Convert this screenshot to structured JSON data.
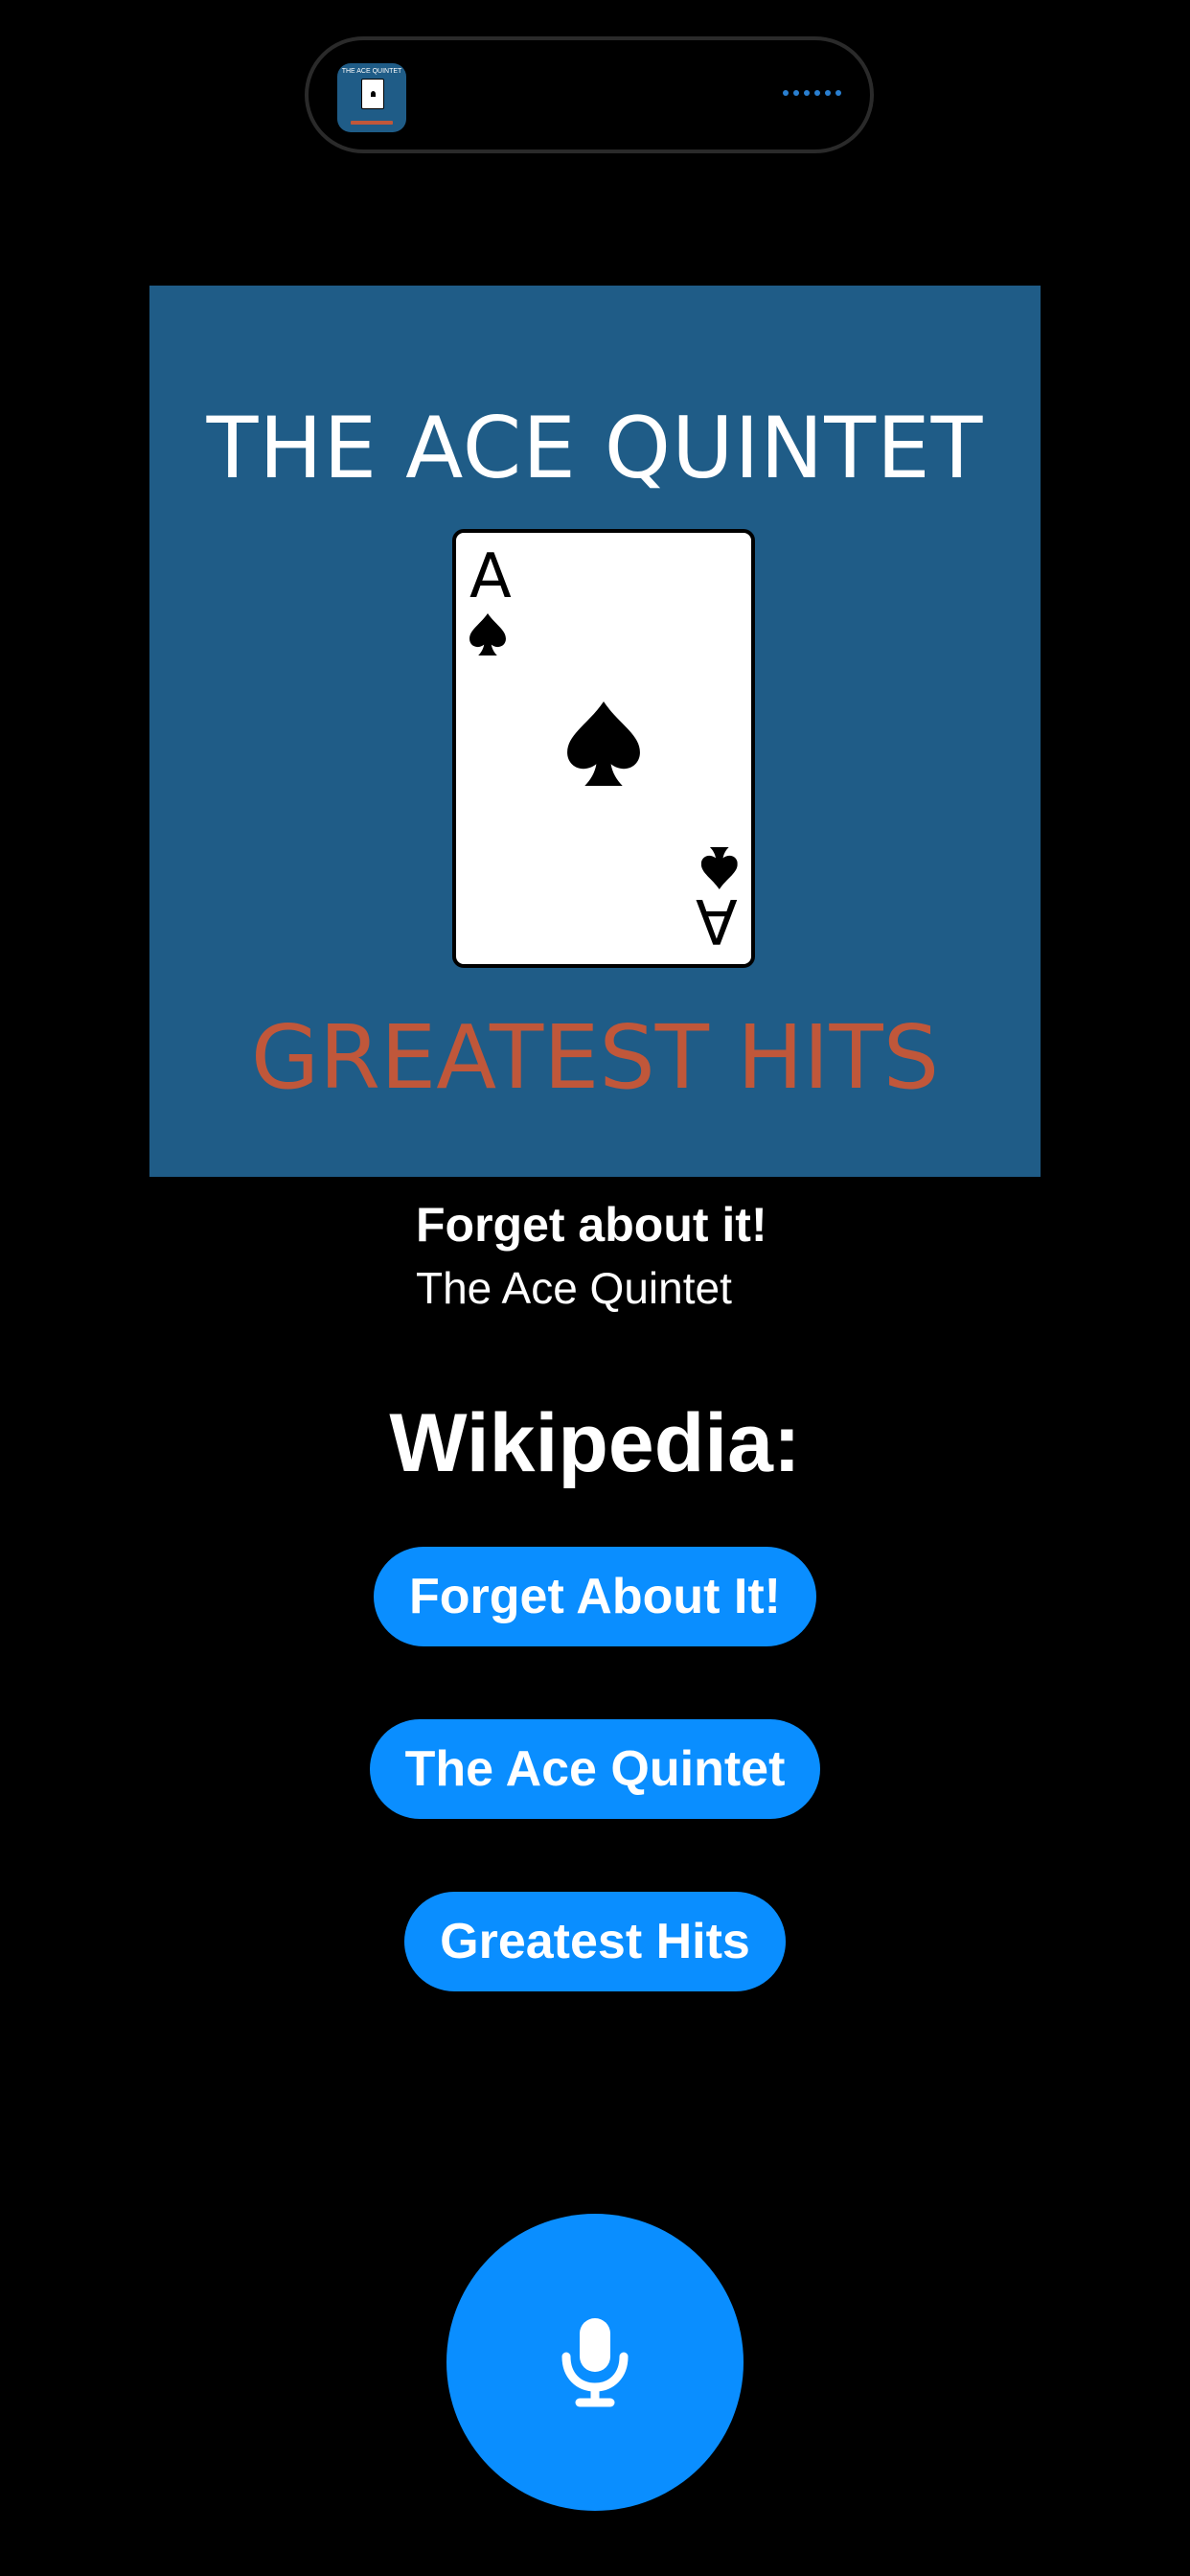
{
  "live_activity": {
    "thumbnail_title": "THE ACE QUINTET",
    "thumbnail_icon": "album-art-thumbnail",
    "indicator_icon": "audio-dots-icon"
  },
  "album_art": {
    "title": "THE ACE QUINTET",
    "subtitle": "GREATEST HITS",
    "card_rank": "A",
    "card_suit": "spade",
    "background_color": "#1f5c87",
    "subtitle_color": "#c0573a"
  },
  "track": {
    "title": "Forget about it!",
    "artist": "The Ace Quintet"
  },
  "wikipedia": {
    "heading": "Wikipedia:",
    "links": [
      {
        "label": "Forget About It!"
      },
      {
        "label": "The Ace Quintet"
      },
      {
        "label": "Greatest Hits"
      }
    ]
  },
  "mic_button": {
    "icon": "microphone-icon"
  },
  "colors": {
    "background": "#000000",
    "accent": "#0a8eff"
  }
}
